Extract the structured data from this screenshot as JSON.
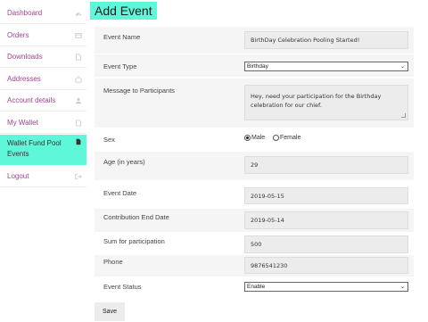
{
  "sidebar": {
    "items": [
      {
        "label": "Dashboard",
        "icon": "dashboard-icon"
      },
      {
        "label": "Orders",
        "icon": "orders-icon"
      },
      {
        "label": "Downloads",
        "icon": "file-icon"
      },
      {
        "label": "Addresses",
        "icon": "home-icon"
      },
      {
        "label": "Account details",
        "icon": "user-icon"
      },
      {
        "label": "My Wallet",
        "icon": "file-icon"
      },
      {
        "label": "Wallet Fund Pool Events",
        "icon": "file-icon"
      },
      {
        "label": "Logout",
        "icon": "logout-icon"
      }
    ],
    "active_index": 6
  },
  "page": {
    "title": "Add Event"
  },
  "form": {
    "event_name": {
      "label": "Event Name",
      "value": "BirthDay Celebration Pooling Started!"
    },
    "event_type": {
      "label": "Event Type",
      "value": "Birthday"
    },
    "message": {
      "label": "Message to Participants",
      "value": "Hey, need your participation for the Birthday celebration for our chief."
    },
    "sex": {
      "label": "Sex",
      "options": [
        "Male",
        "Female"
      ],
      "selected": "Male"
    },
    "age": {
      "label": "Age (in years)",
      "value": "29"
    },
    "event_date": {
      "label": "Event Date",
      "value": "2019-05-15"
    },
    "contribution_end": {
      "label": "Contribution End Date",
      "value": "2019-05-14"
    },
    "sum": {
      "label": "Sum for participation",
      "value": "500"
    },
    "phone": {
      "label": "Phone",
      "value": "9876541230"
    },
    "status": {
      "label": "Event Status",
      "value": "Enable"
    },
    "save_label": "Save"
  },
  "colors": {
    "accent": "#5ef7d9",
    "link": "#a0458d",
    "field_bg": "#ececec",
    "row_bg": "#f5f5f5"
  }
}
